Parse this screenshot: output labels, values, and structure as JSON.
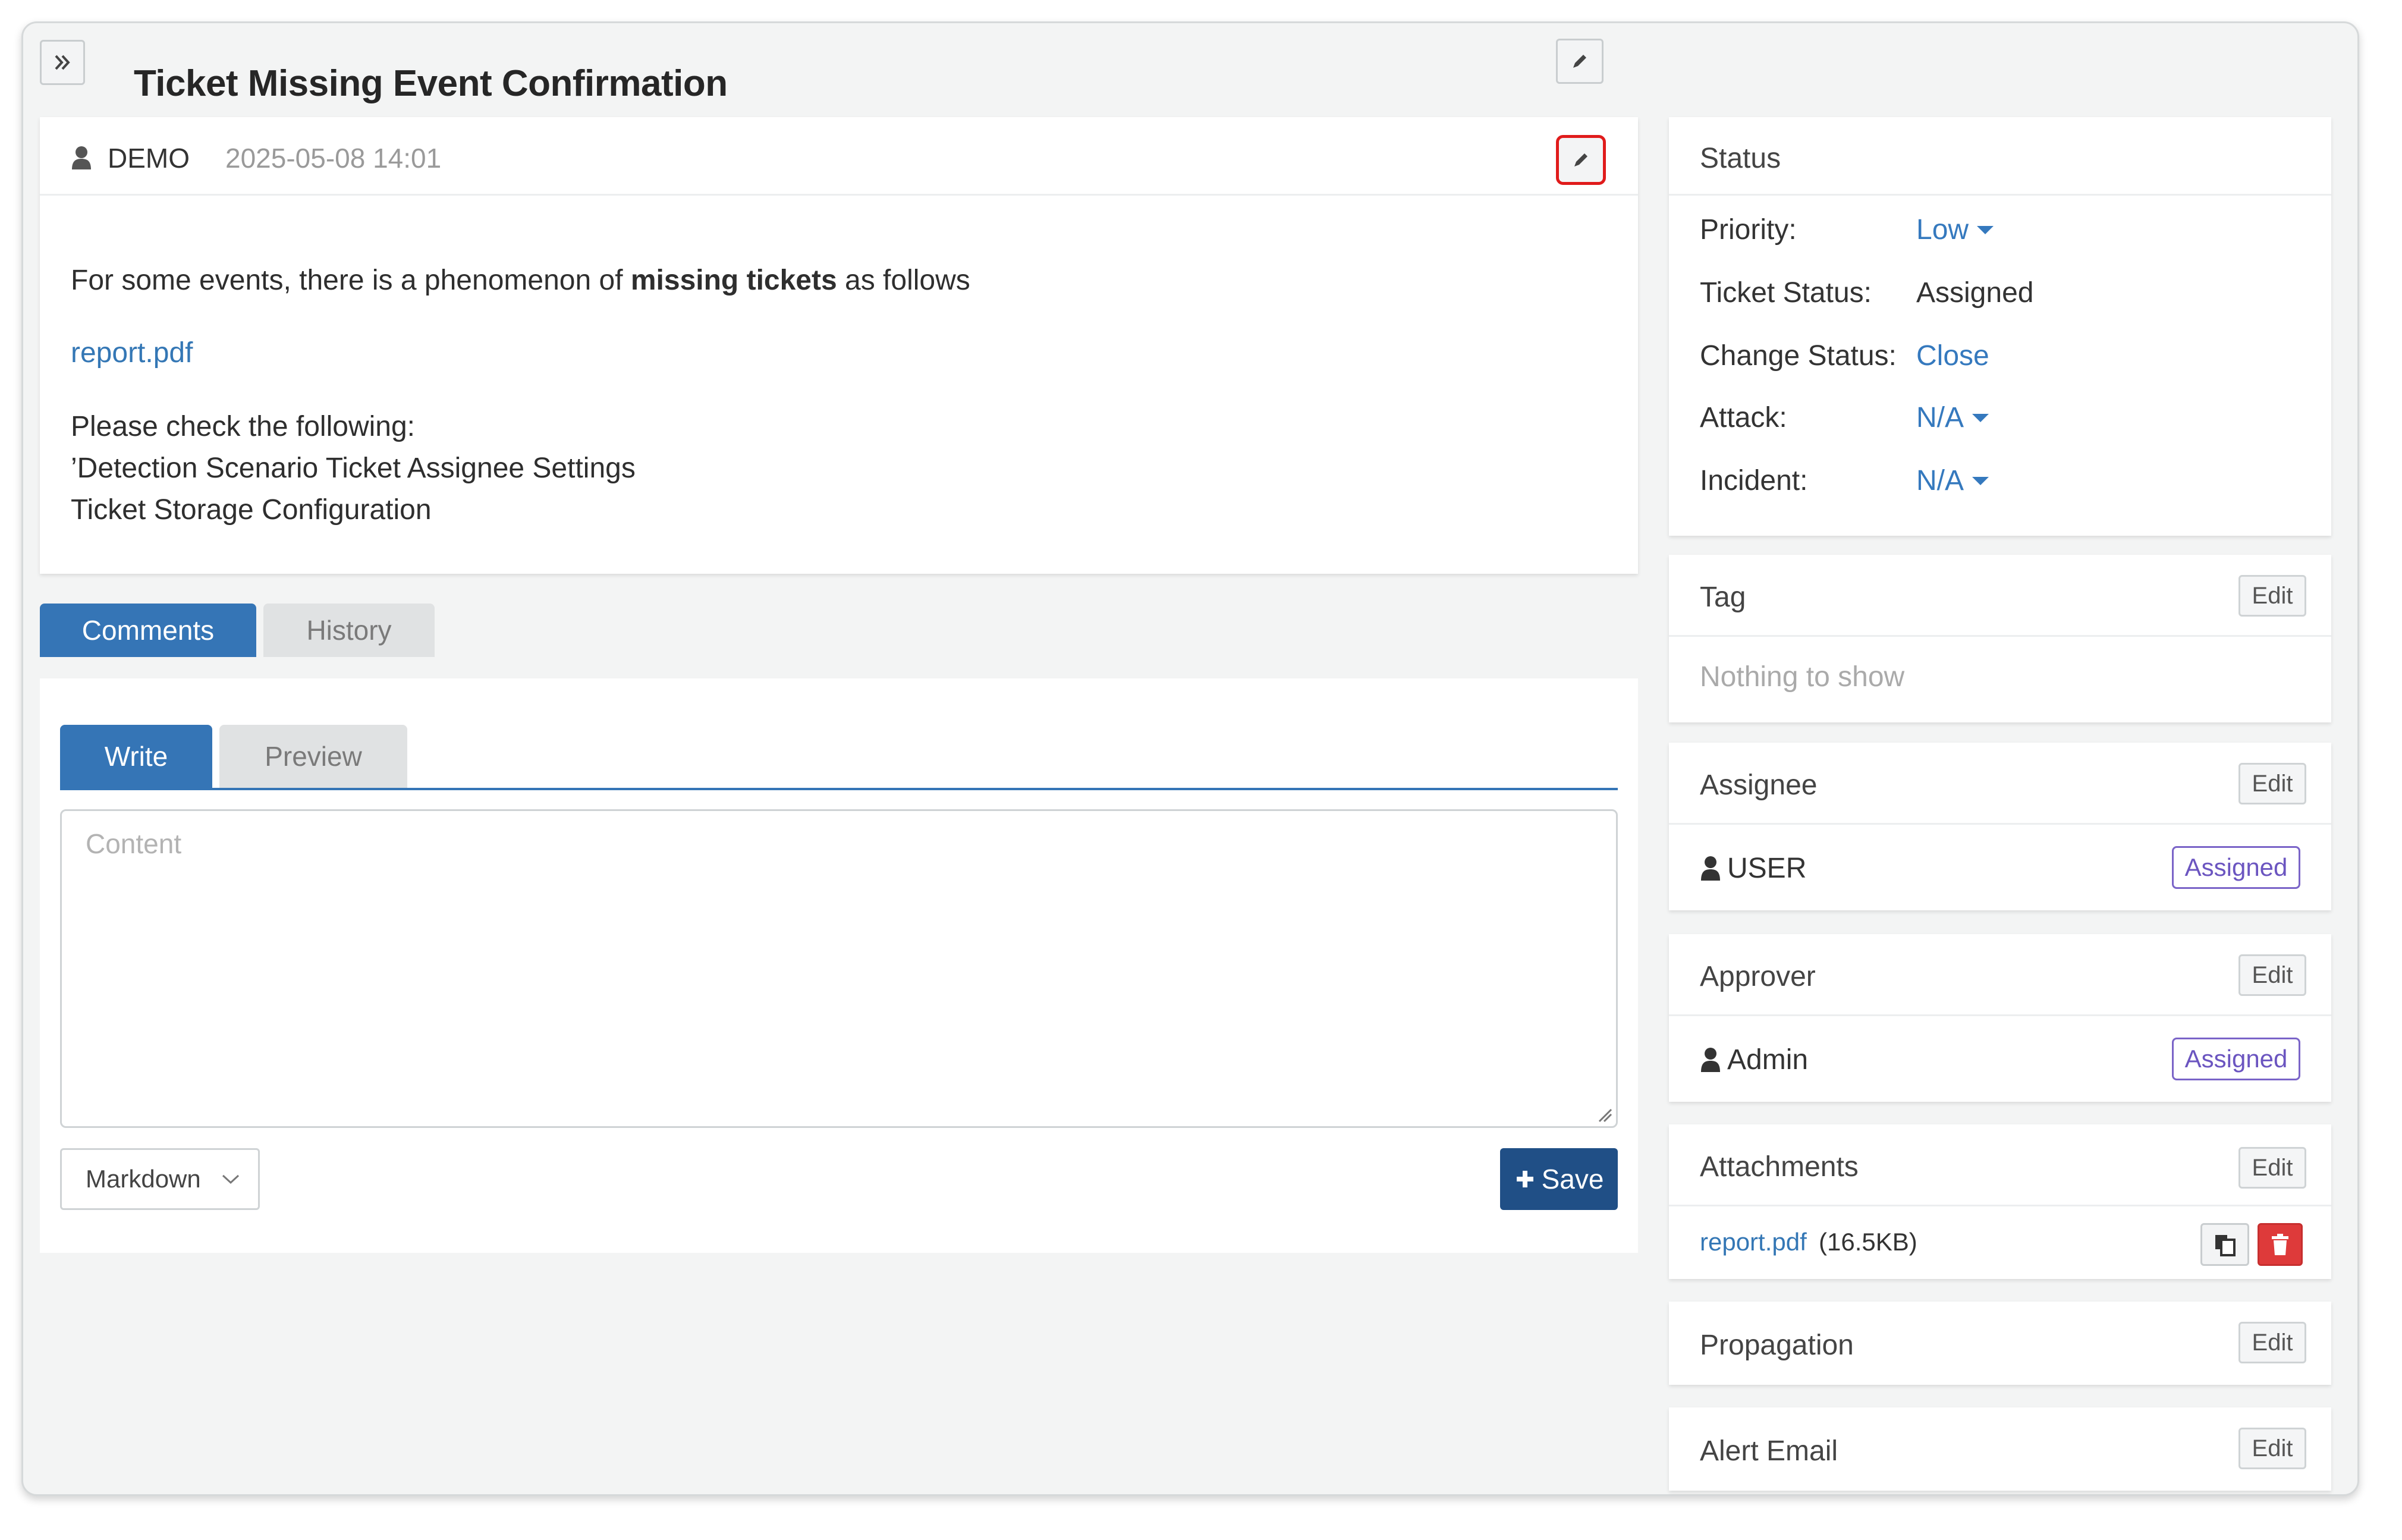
{
  "header": {
    "title": "Ticket Missing Event Confirmation"
  },
  "post": {
    "author": "DEMO",
    "timestamp": "2025-05-08 14:01",
    "text_before_bold": "For some events, there is a phenomenon of ",
    "text_bold": "missing tickets",
    "text_after_bold": " as follows",
    "attachment_link": "report.pdf",
    "check_line_1": "Please check the following:",
    "check_line_2": "’Detection Scenario Ticket Assignee Settings",
    "check_line_3": "Ticket Storage Configuration"
  },
  "tabs": {
    "comments": "Comments",
    "history": "History"
  },
  "editor": {
    "write_tab": "Write",
    "preview_tab": "Preview",
    "content_placeholder": "Content",
    "format_selected": "Markdown",
    "save_label": "Save"
  },
  "status": {
    "title": "Status",
    "priority_label": "Priority:",
    "priority_value": "Low",
    "ticket_status_label": "Ticket Status:",
    "ticket_status_value": "Assigned",
    "change_status_label": "Change Status:",
    "change_status_value": "Close",
    "attack_label": "Attack:",
    "attack_value": "N/A",
    "incident_label": "Incident:",
    "incident_value": "N/A"
  },
  "tag": {
    "title": "Tag",
    "edit": "Edit",
    "empty": "Nothing to show"
  },
  "assignee": {
    "title": "Assignee",
    "edit": "Edit",
    "user": "USER",
    "badge": "Assigned"
  },
  "approver": {
    "title": "Approver",
    "edit": "Edit",
    "user": "Admin",
    "badge": "Assigned"
  },
  "attachments": {
    "title": "Attachments",
    "edit": "Edit",
    "file_name": "report.pdf",
    "file_size": "(16.5KB)"
  },
  "propagation": {
    "title": "Propagation",
    "edit": "Edit"
  },
  "alert_email": {
    "title": "Alert Email",
    "edit": "Edit"
  },
  "colors": {
    "primary": "#3575b6",
    "save": "#204f86",
    "link": "#3579be",
    "badge": "#7a64c8",
    "danger": "#de3a3a",
    "highlight": "#e01b1b"
  }
}
